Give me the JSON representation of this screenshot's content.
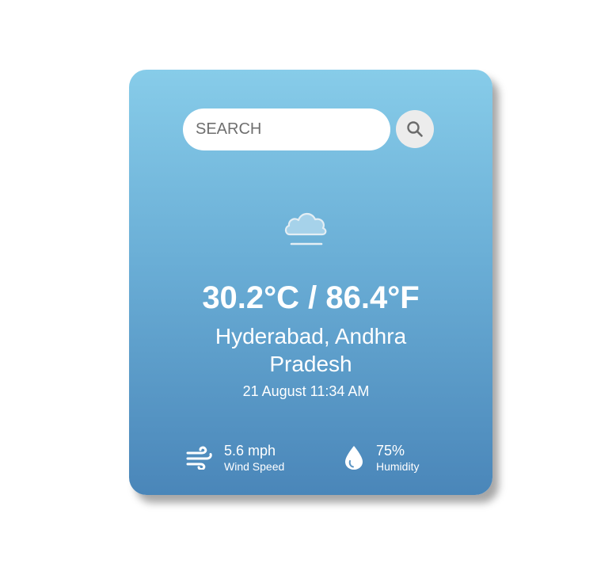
{
  "search": {
    "placeholder": "SEARCH",
    "button_icon": "search-icon"
  },
  "weather": {
    "icon": "mist-cloud-icon",
    "temperature": "30.2°C / 86.4°F",
    "location": "Hyderabad, Andhra Pradesh",
    "datetime": "21 August 11:34 AM"
  },
  "stats": {
    "wind": {
      "icon": "wind-icon",
      "value": "5.6 mph",
      "label": "Wind Speed"
    },
    "humidity": {
      "icon": "water-drop-icon",
      "value": "75%",
      "label": "Humidity"
    }
  },
  "colors": {
    "card_gradient_top": "#87cce9",
    "card_gradient_bottom": "#4a86b9",
    "text": "#ffffff"
  }
}
